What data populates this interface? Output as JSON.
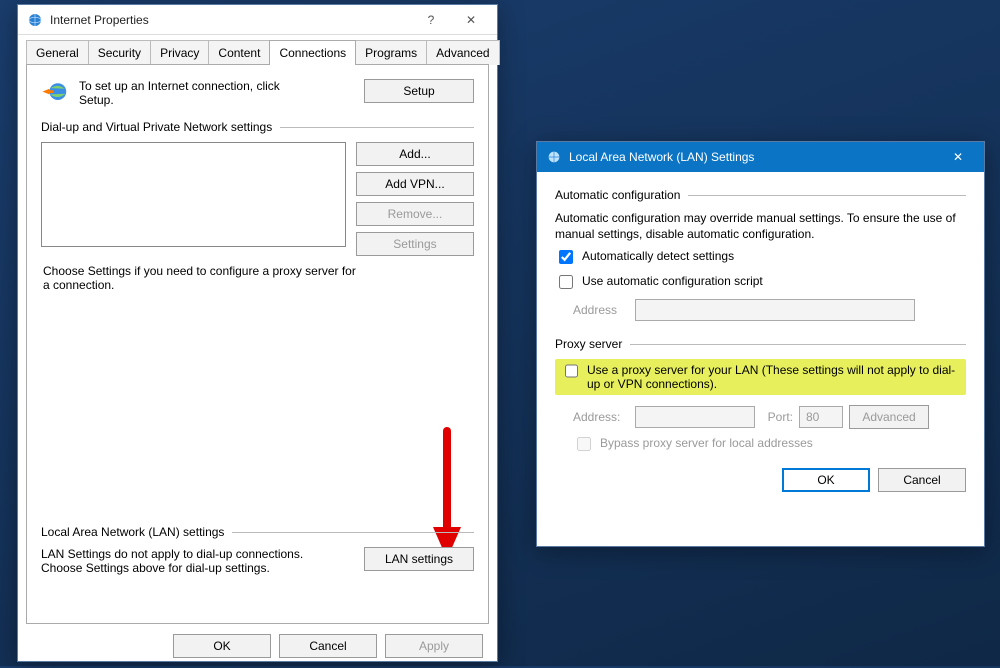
{
  "ip": {
    "title": "Internet Properties",
    "tabs": [
      "General",
      "Security",
      "Privacy",
      "Content",
      "Connections",
      "Programs",
      "Advanced"
    ],
    "active_tab": "Connections",
    "setup_hint": "To set up an Internet connection, click Setup.",
    "btn_setup": "Setup",
    "grp_dialup": "Dial-up and Virtual Private Network settings",
    "btn_add": "Add...",
    "btn_add_vpn": "Add VPN...",
    "btn_remove": "Remove...",
    "btn_settings": "Settings",
    "dialup_note": "Choose Settings if you need to configure a proxy server for a connection.",
    "grp_lan": "Local Area Network (LAN) settings",
    "lan_note": "LAN Settings do not apply to dial-up connections. Choose Settings above for dial-up settings.",
    "btn_lan": "LAN settings",
    "btn_ok": "OK",
    "btn_cancel": "Cancel",
    "btn_apply": "Apply"
  },
  "lan": {
    "title": "Local Area Network (LAN) Settings",
    "grp_auto": "Automatic configuration",
    "auto_note": "Automatic configuration may override manual settings.  To ensure the use of manual settings, disable automatic configuration.",
    "cb_auto_detect": "Automatically detect settings",
    "cb_auto_script": "Use automatic configuration script",
    "lbl_address": "Address",
    "grp_proxy": "Proxy server",
    "cb_use_proxy": "Use a proxy server for your LAN (These settings will not apply to dial-up or VPN connections).",
    "lbl_address2": "Address:",
    "lbl_port": "Port:",
    "port_value": "80",
    "btn_advanced": "Advanced",
    "cb_bypass": "Bypass proxy server for local addresses",
    "btn_ok": "OK",
    "btn_cancel": "Cancel"
  }
}
